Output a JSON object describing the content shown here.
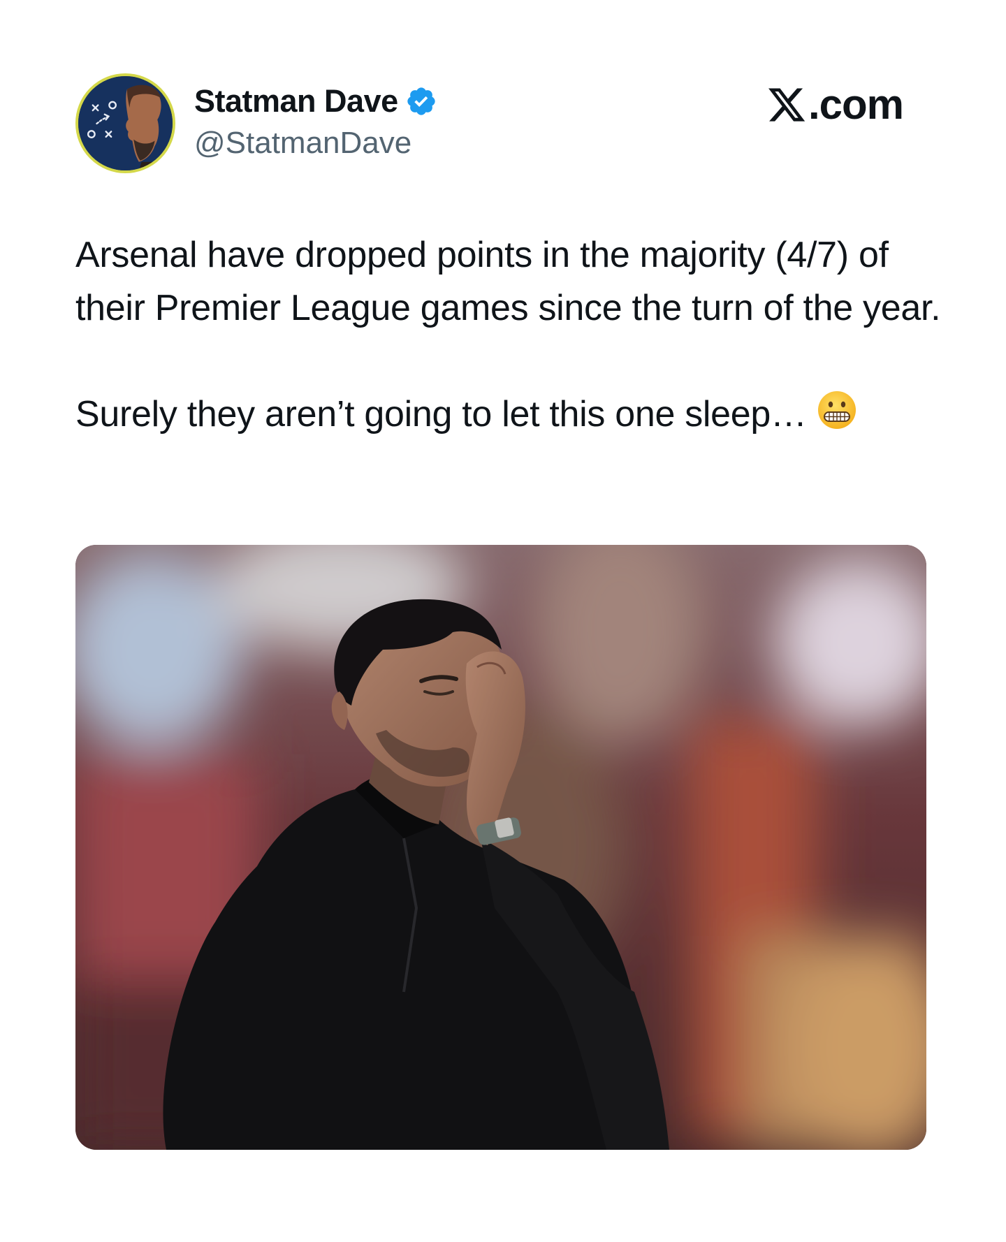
{
  "author": {
    "display_name": "Statman Dave",
    "handle": "@StatmanDave",
    "verified": true,
    "avatar_icon": "tactics-board-avatar-icon"
  },
  "brand": {
    "logo_icon": "x-logo-icon",
    "label": ".com"
  },
  "tweet": {
    "paragraph_1": "Arsenal have dropped points in the majority (4/7) of their Premier League games since the turn of the year.",
    "paragraph_2": "Surely they aren’t going to let this one sleep…",
    "emoji": "grimacing-face-emoji"
  },
  "media": {
    "type": "photo",
    "subject": "man-in-black-quarter-zip-holding-forehead"
  },
  "colors": {
    "text": "#0f1419",
    "secondary_text": "#536471",
    "verified_badge": "#1d9bf0",
    "avatar_bg": "#16315e",
    "avatar_ring": "#d4d84a"
  }
}
